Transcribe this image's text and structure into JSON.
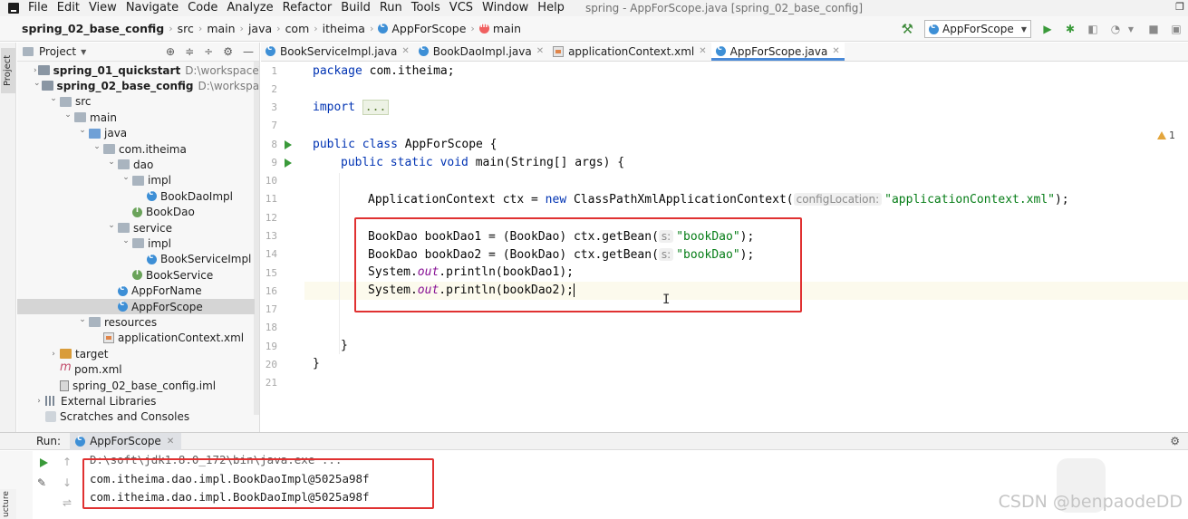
{
  "menu": {
    "items": [
      "File",
      "Edit",
      "View",
      "Navigate",
      "Code",
      "Analyze",
      "Refactor",
      "Build",
      "Run",
      "Tools",
      "VCS",
      "Window",
      "Help"
    ],
    "window_title": "spring - AppForScope.java [spring_02_base_config]"
  },
  "breadcrumbs": [
    "spring_02_base_config",
    "src",
    "main",
    "java",
    "com",
    "itheima",
    "AppForScope",
    "main"
  ],
  "run_config": {
    "label": "AppForScope"
  },
  "project": {
    "title": "Project",
    "tree": [
      {
        "label": "spring_01_quickstart",
        "path": "D:\\workspace\\sp",
        "bold": true,
        "indent": 0,
        "arrow": "›",
        "icon": "module"
      },
      {
        "label": "spring_02_base_config",
        "path": "D:\\workspace\\s",
        "bold": true,
        "indent": 0,
        "arrow": "⌄",
        "icon": "module"
      },
      {
        "label": "src",
        "indent": 1,
        "arrow": "⌄",
        "icon": "folder"
      },
      {
        "label": "main",
        "indent": 2,
        "arrow": "⌄",
        "icon": "folder"
      },
      {
        "label": "java",
        "indent": 3,
        "arrow": "⌄",
        "icon": "folder-blue"
      },
      {
        "label": "com.itheima",
        "indent": 4,
        "arrow": "⌄",
        "icon": "folder"
      },
      {
        "label": "dao",
        "indent": 5,
        "arrow": "⌄",
        "icon": "folder"
      },
      {
        "label": "impl",
        "indent": 6,
        "arrow": "⌄",
        "icon": "folder"
      },
      {
        "label": "BookDaoImpl",
        "indent": 7,
        "arrow": "",
        "icon": "class"
      },
      {
        "label": "BookDao",
        "indent": 6,
        "arrow": "",
        "icon": "interface"
      },
      {
        "label": "service",
        "indent": 5,
        "arrow": "⌄",
        "icon": "folder"
      },
      {
        "label": "impl",
        "indent": 6,
        "arrow": "⌄",
        "icon": "folder"
      },
      {
        "label": "BookServiceImpl",
        "indent": 7,
        "arrow": "",
        "icon": "class"
      },
      {
        "label": "BookService",
        "indent": 6,
        "arrow": "",
        "icon": "interface"
      },
      {
        "label": "AppForName",
        "indent": 5,
        "arrow": "",
        "icon": "class"
      },
      {
        "label": "AppForScope",
        "indent": 5,
        "arrow": "",
        "icon": "class",
        "selected": true
      },
      {
        "label": "resources",
        "indent": 3,
        "arrow": "⌄",
        "icon": "folder-res"
      },
      {
        "label": "applicationContext.xml",
        "indent": 4,
        "arrow": "",
        "icon": "xml"
      },
      {
        "label": "target",
        "indent": 1,
        "arrow": "›",
        "icon": "folder-orange"
      },
      {
        "label": "pom.xml",
        "indent": 1,
        "arrow": "",
        "icon": "maven"
      },
      {
        "label": "spring_02_base_config.iml",
        "indent": 1,
        "arrow": "",
        "icon": "iml"
      },
      {
        "label": "External Libraries",
        "indent": 0,
        "arrow": "›",
        "icon": "lib"
      },
      {
        "label": "Scratches and Consoles",
        "indent": 0,
        "arrow": "",
        "icon": "scratch"
      }
    ]
  },
  "editor_tabs": [
    {
      "label": "BookServiceImpl.java",
      "icon": "class"
    },
    {
      "label": "BookDaoImpl.java",
      "icon": "class"
    },
    {
      "label": "applicationContext.xml",
      "icon": "xml"
    },
    {
      "label": "AppForScope.java",
      "icon": "class",
      "active": true
    }
  ],
  "editor": {
    "line_numbers": [
      "1",
      "2",
      "3",
      "7",
      "8",
      "9",
      "10",
      "11",
      "12",
      "13",
      "14",
      "15",
      "16",
      "17",
      "18",
      "19",
      "20",
      "21"
    ],
    "inspection_count": "1",
    "code": {
      "l1_kw": "package",
      "l1_rest": " com.itheima;",
      "l3_kw": "import",
      "l3_dots": "...",
      "l8_kw": "public class",
      "l8_rest": " AppForScope {",
      "l9_kw": "public static void",
      "l9_rest": " main(String[] args) {",
      "l11_a": "ApplicationContext ctx = ",
      "l11_kw": "new",
      "l11_b": " ClassPathXmlApplicationContext(",
      "l11_hint": "configLocation:",
      "l11_str": "\"applicationContext.xml\"",
      "l11_c": ");",
      "l13_a": "BookDao bookDao1 = (BookDao) ctx.getBean(",
      "l13_hint": "s:",
      "l13_str": "\"bookDao\"",
      "l13_c": ");",
      "l14_a": "BookDao bookDao2 = (BookDao) ctx.getBean(",
      "l14_hint": "s:",
      "l14_str": "\"bookDao\"",
      "l14_c": ");",
      "l15_a": "System.",
      "l15_fld": "out",
      "l15_b": ".println(bookDao1);",
      "l16_a": "System.",
      "l16_fld": "out",
      "l16_b": ".println(bookDao2);",
      "l19": "}",
      "l20": "}"
    }
  },
  "run": {
    "label": "Run:",
    "tab_label": "AppForScope",
    "console": [
      "D:\\soft\\jdk1.8.0_172\\bin\\java.exe ...",
      "com.itheima.dao.impl.BookDaoImpl@5025a98f",
      "com.itheima.dao.impl.BookDaoImpl@5025a98f"
    ]
  },
  "side_labels": {
    "project": "Project",
    "structure": "ucture"
  },
  "watermark": "CSDN @benpaodeDD",
  "colors": {
    "highlight_box": "#e03131",
    "keyword": "#0033b3",
    "string": "#067d17",
    "field": "#871094"
  }
}
